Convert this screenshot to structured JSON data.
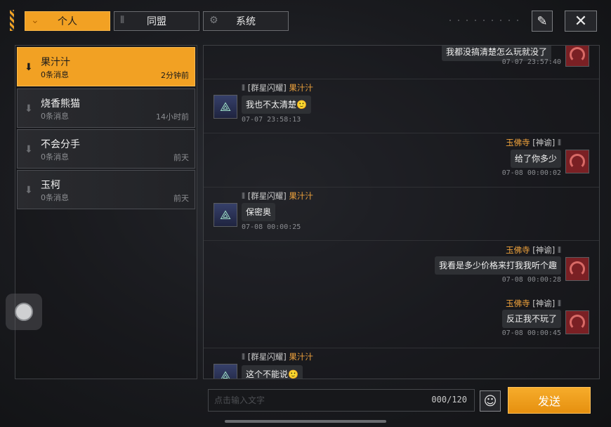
{
  "tabs": [
    {
      "label": "个人",
      "icon": "chevron-down-icon",
      "active": true
    },
    {
      "label": "同盟",
      "icon": "alliance-icon",
      "active": false
    },
    {
      "label": "系统",
      "icon": "gear-icon",
      "active": false
    }
  ],
  "top_buttons": {
    "edit_icon": "pencil-icon",
    "close_icon": "close-icon"
  },
  "conversations": [
    {
      "name": "果汁汁",
      "unread": "0条消息",
      "time": "2分钟前",
      "active": true
    },
    {
      "name": "烧香熊猫",
      "unread": "0条消息",
      "time": "14小时前",
      "active": false
    },
    {
      "name": "不会分手",
      "unread": "0条消息",
      "time": "前天",
      "active": false
    },
    {
      "name": "玉柯",
      "unread": "0条消息",
      "time": "前天",
      "active": false
    }
  ],
  "messages": [
    {
      "side": "right",
      "sender": "",
      "tag": "",
      "text": "我都没搞清楚怎么玩就没了",
      "time": "07-07 23:57:40"
    },
    {
      "side": "left",
      "sender": "果汁汁",
      "tag": "[群星闪耀]",
      "text": "我也不太清楚🙂",
      "time": "07-07 23:58:13"
    },
    {
      "side": "right",
      "sender": "玉佛寺",
      "tag": "[神谕]",
      "text": "给了你多少",
      "time": "07-08 00:00:02"
    },
    {
      "side": "left",
      "sender": "果汁汁",
      "tag": "[群星闪耀]",
      "text": "保密奥",
      "time": "07-08 00:00:25"
    },
    {
      "side": "right",
      "sender": "玉佛寺",
      "tag": "[神谕]",
      "text": "我看是多少价格来打我我听个趣",
      "time": "07-08 00:00:28"
    },
    {
      "side": "right",
      "sender": "玉佛寺",
      "tag": "[神谕]",
      "text": "反正我不玩了",
      "time": "07-08 00:00:45"
    },
    {
      "side": "left",
      "sender": "果汁汁",
      "tag": "[群星闪耀]",
      "text": "这个不能说🙂",
      "time": ""
    }
  ],
  "input": {
    "placeholder": "点击输入文字",
    "counter": "000/120"
  },
  "send_label": "发送",
  "colors": {
    "accent": "#f2a123",
    "sender": "#f0a33c"
  }
}
